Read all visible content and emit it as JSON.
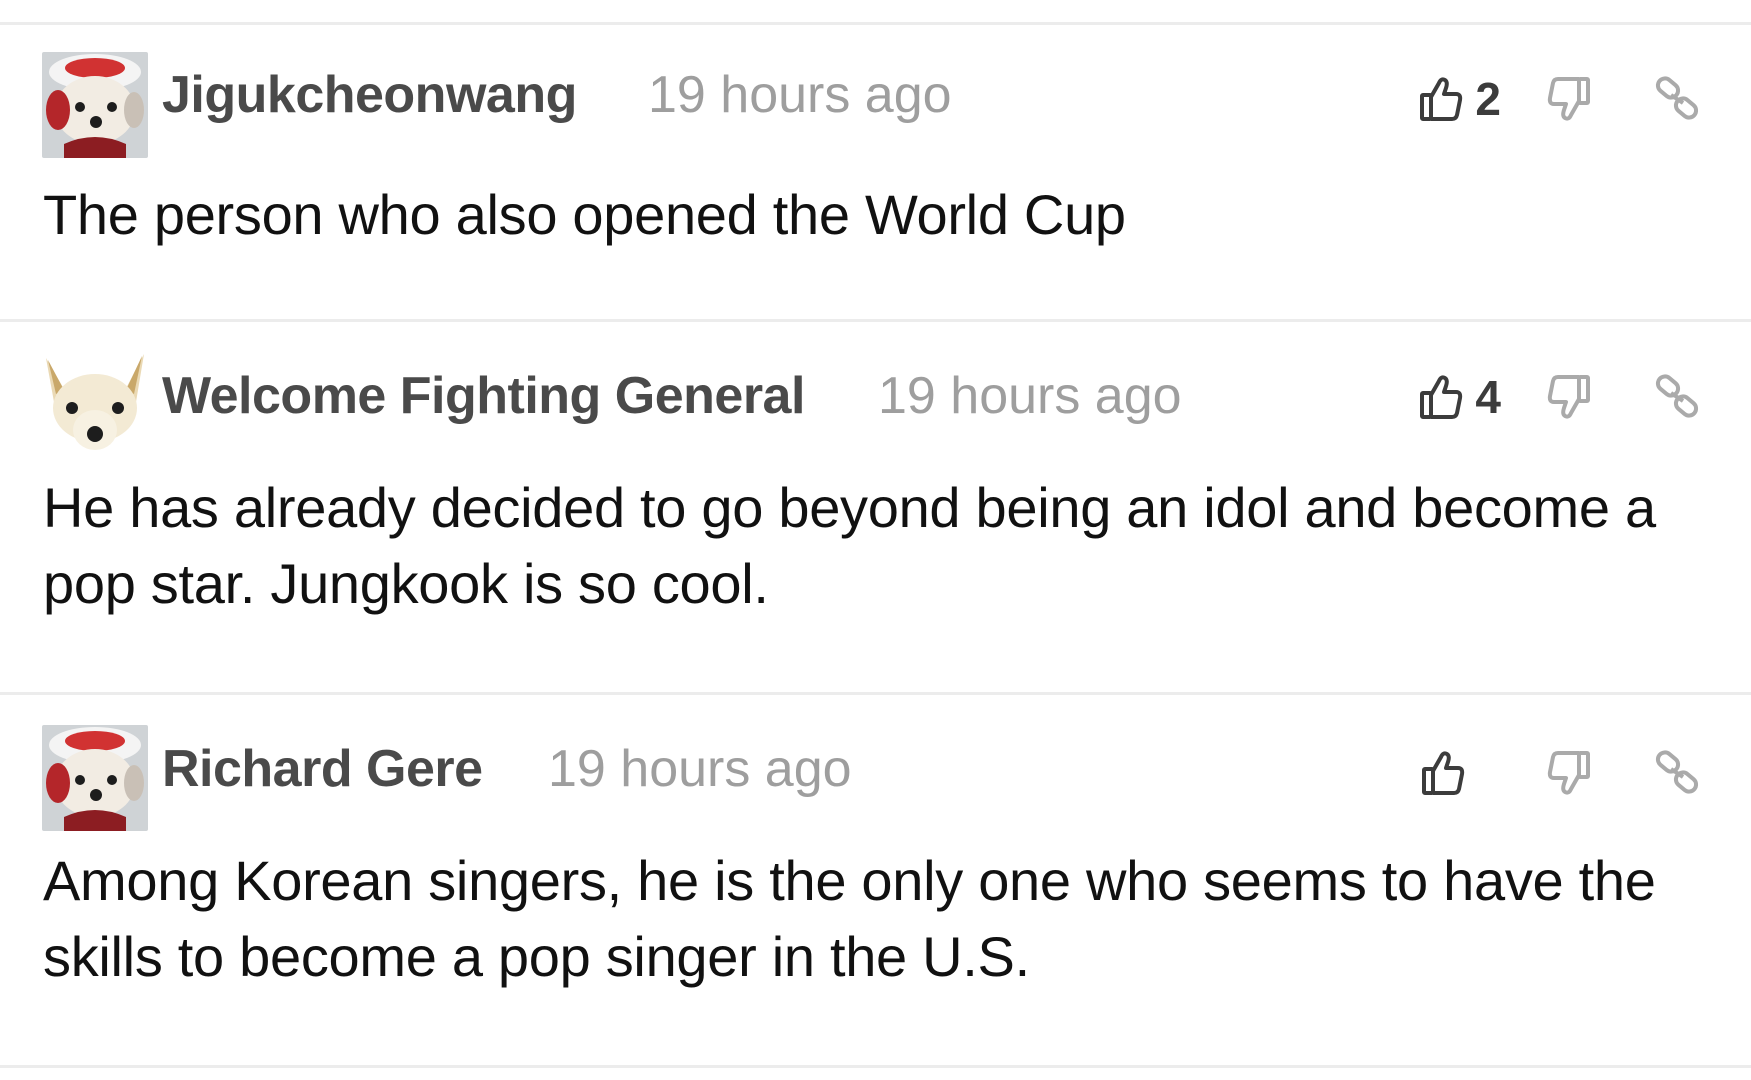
{
  "comments": [
    {
      "username": "Jigukcheonwang",
      "timestamp": "19 hours ago",
      "likes": "2",
      "text": "The person who also opened the World Cup",
      "avatar": "santa-puppy-avatar"
    },
    {
      "username": "Welcome Fighting General",
      "timestamp": "19 hours ago",
      "likes": "4",
      "text": "He has already decided to go beyond being an idol and become a pop star. Jungkook is so cool.",
      "avatar": "puppy-avatar"
    },
    {
      "username": "Richard Gere",
      "timestamp": "19 hours ago",
      "likes": "",
      "text": "Among Korean singers, he is the only one who seems to have the skills to become a pop singer in the U.S.",
      "avatar": "santa-puppy-avatar"
    }
  ],
  "icons": {
    "like": "thumbs-up-icon",
    "dislike": "thumbs-down-icon",
    "link": "link-icon"
  },
  "colors": {
    "username": "#4a4a4a",
    "timestamp": "#9e9e9e",
    "divider": "#ececec",
    "icon": "#3c3c3c",
    "icon_muted": "#aaaaaa"
  }
}
